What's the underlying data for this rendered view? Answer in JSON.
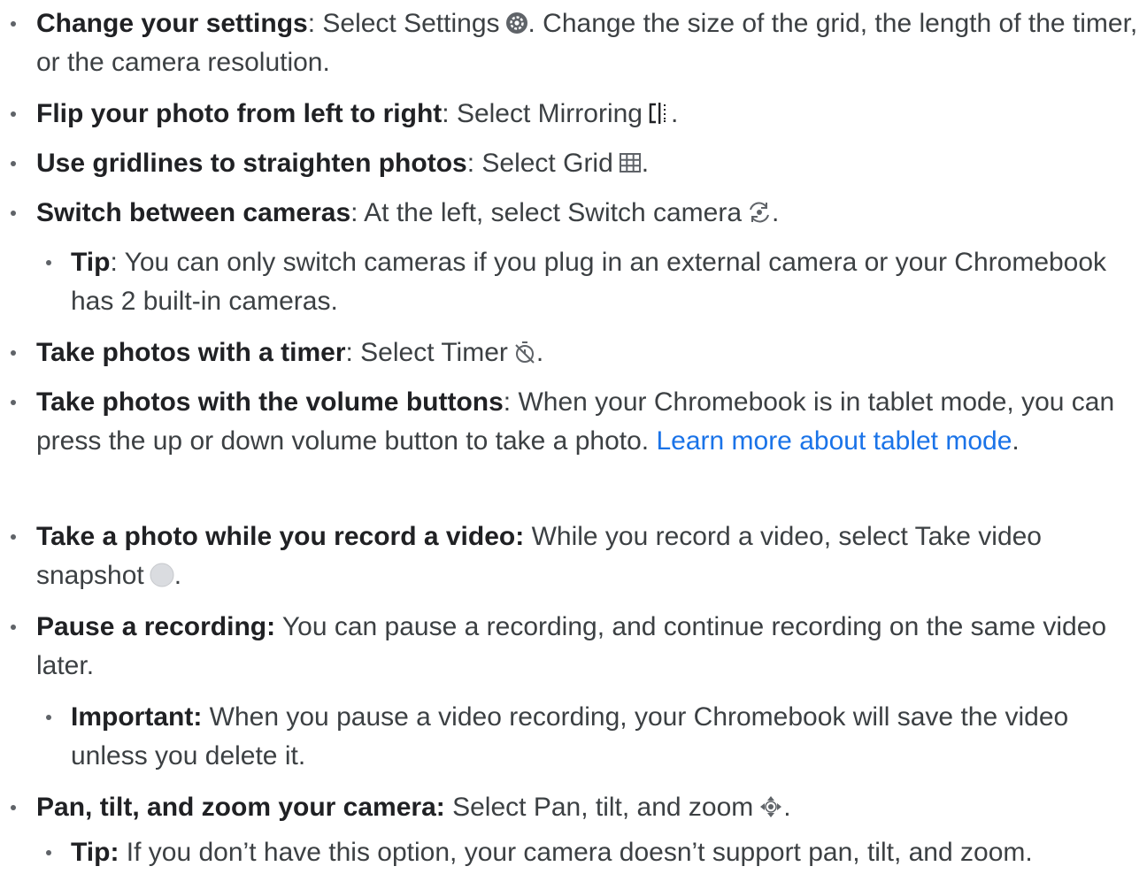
{
  "items": [
    {
      "term": "Change your settings",
      "sep": ": ",
      "text": "Select Settings",
      "icon": "settings-icon",
      "after": ". Change the size of the grid, the length of the timer, or the camera resolution."
    },
    {
      "term": "Flip your photo from left to right",
      "sep": ": ",
      "text": "Select Mirroring",
      "icon": "mirroring-icon",
      "after": "."
    },
    {
      "term": "Use gridlines to straighten photos",
      "sep": ": ",
      "text": "Select Grid",
      "icon": "grid-icon",
      "after": "."
    },
    {
      "term": "Switch between cameras",
      "sep": ": ",
      "text": "At the left, select Switch camera",
      "icon": "switch-camera-icon",
      "after": "."
    },
    {
      "term": "Tip",
      "sep": ": ",
      "text": "You can only switch cameras if you plug in an external camera or your Chromebook has 2 built-in cameras."
    },
    {
      "term": "Take photos with a timer",
      "sep": ": ",
      "text": "Select Timer",
      "icon": "timer-icon",
      "after": "."
    },
    {
      "term": "Take photos with the volume buttons",
      "sep": ": ",
      "text": "When your Chromebook is in tablet mode, you can press the up or down volume button to take a photo.",
      "link": "Learn more about tablet mode",
      "after": "."
    },
    {
      "term": "Take a photo while you record a video:",
      "sep": " ",
      "text": "While you record a video, select Take video snapshot",
      "icon": "snapshot-icon",
      "after": "."
    },
    {
      "term": "Pause a recording:",
      "sep": " ",
      "text": "You can pause a recording, and continue recording on the same video later."
    },
    {
      "term": "Important:",
      "sep": " ",
      "text": "When you pause a video recording, your Chromebook will save the video unless you delete it."
    },
    {
      "term": "Pan, tilt, and zoom your camera:",
      "sep": " ",
      "text": "Select Pan, tilt, and zoom",
      "icon": "pan-tilt-zoom-icon",
      "after": "."
    },
    {
      "term": "Tip:",
      "sep": " ",
      "text": "If you don’t have this option, your camera doesn’t support pan, tilt, and zoom."
    }
  ],
  "colors": {
    "text": "#3c4043",
    "term": "#202124",
    "link": "#1a73e8",
    "bullet": "#5f6368"
  }
}
